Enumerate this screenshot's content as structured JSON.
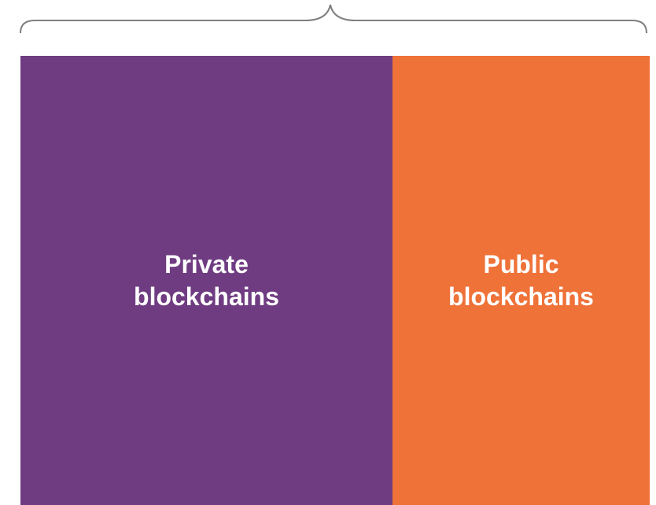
{
  "top_title": "",
  "colors": {
    "private": "#6f3c82",
    "public": "#ef7239",
    "brace": "#7f7f7f"
  },
  "panels": {
    "private": {
      "label": "Private\nblockchains"
    },
    "public": {
      "label": "Public\nblockchains"
    }
  }
}
